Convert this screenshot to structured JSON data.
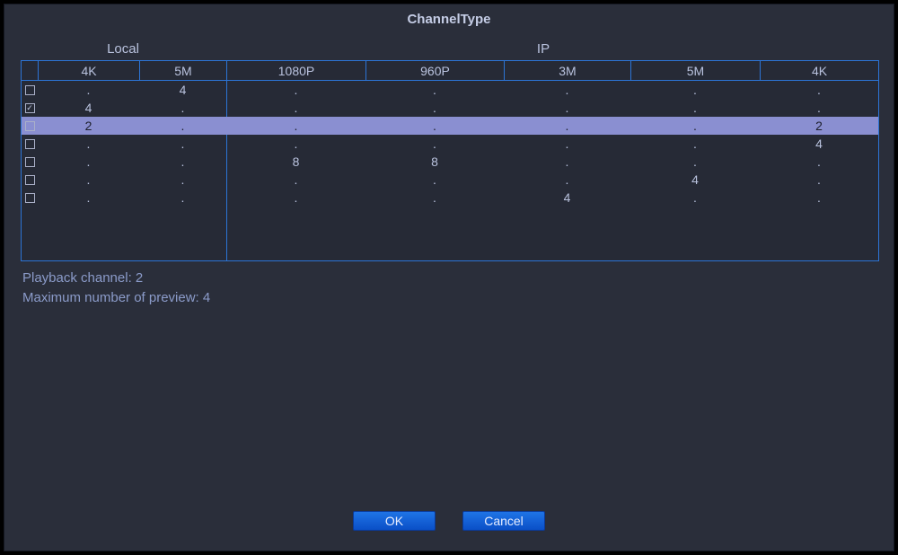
{
  "title": "ChannelType",
  "groups": {
    "local": "Local",
    "ip": "IP"
  },
  "columns": [
    "4K",
    "5M",
    "1080P",
    "960P",
    "3M",
    "5M",
    "4K"
  ],
  "rows": [
    {
      "checked": false,
      "selected": false,
      "cells": [
        ".",
        "4",
        ".",
        ".",
        ".",
        ".",
        "."
      ]
    },
    {
      "checked": true,
      "selected": false,
      "cells": [
        "4",
        ".",
        ".",
        ".",
        ".",
        ".",
        "."
      ]
    },
    {
      "checked": false,
      "selected": true,
      "cells": [
        "2",
        ".",
        ".",
        ".",
        ".",
        ".",
        "2"
      ]
    },
    {
      "checked": false,
      "selected": false,
      "cells": [
        ".",
        ".",
        ".",
        ".",
        ".",
        ".",
        "4"
      ]
    },
    {
      "checked": false,
      "selected": false,
      "cells": [
        ".",
        ".",
        "8",
        "8",
        ".",
        ".",
        "."
      ]
    },
    {
      "checked": false,
      "selected": false,
      "cells": [
        ".",
        ".",
        ".",
        ".",
        ".",
        "4",
        "."
      ]
    },
    {
      "checked": false,
      "selected": false,
      "cells": [
        ".",
        ".",
        ".",
        ".",
        "4",
        ".",
        "."
      ]
    }
  ],
  "footer": {
    "playback_label": "Playback channel: 2",
    "preview_label": "Maximum number of preview: 4"
  },
  "buttons": {
    "ok": "OK",
    "cancel": "Cancel"
  }
}
